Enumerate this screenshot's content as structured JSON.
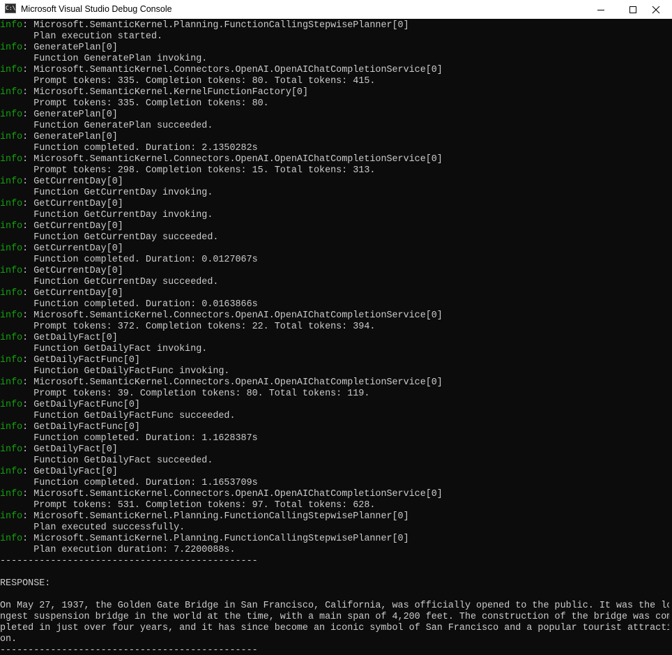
{
  "window": {
    "icon_text": "C:\\",
    "title": "Microsoft Visual Studio Debug Console"
  },
  "log_level_label": "info",
  "log_entries": [
    {
      "level": "info",
      "category": ": Microsoft.SemanticKernel.Planning.FunctionCallingStepwisePlanner[0]",
      "message": "      Plan execution started."
    },
    {
      "level": "info",
      "category": ": GeneratePlan[0]",
      "message": "      Function GeneratePlan invoking."
    },
    {
      "level": "info",
      "category": ": Microsoft.SemanticKernel.Connectors.OpenAI.OpenAIChatCompletionService[0]",
      "message": "      Prompt tokens: 335. Completion tokens: 80. Total tokens: 415."
    },
    {
      "level": "info",
      "category": ": Microsoft.SemanticKernel.KernelFunctionFactory[0]",
      "message": "      Prompt tokens: 335. Completion tokens: 80."
    },
    {
      "level": "info",
      "category": ": GeneratePlan[0]",
      "message": "      Function GeneratePlan succeeded."
    },
    {
      "level": "info",
      "category": ": GeneratePlan[0]",
      "message": "      Function completed. Duration: 2.1350282s"
    },
    {
      "level": "info",
      "category": ": Microsoft.SemanticKernel.Connectors.OpenAI.OpenAIChatCompletionService[0]",
      "message": "      Prompt tokens: 298. Completion tokens: 15. Total tokens: 313."
    },
    {
      "level": "info",
      "category": ": GetCurrentDay[0]",
      "message": "      Function GetCurrentDay invoking."
    },
    {
      "level": "info",
      "category": ": GetCurrentDay[0]",
      "message": "      Function GetCurrentDay invoking."
    },
    {
      "level": "info",
      "category": ": GetCurrentDay[0]",
      "message": "      Function GetCurrentDay succeeded."
    },
    {
      "level": "info",
      "category": ": GetCurrentDay[0]",
      "message": "      Function completed. Duration: 0.0127067s"
    },
    {
      "level": "info",
      "category": ": GetCurrentDay[0]",
      "message": "      Function GetCurrentDay succeeded."
    },
    {
      "level": "info",
      "category": ": GetCurrentDay[0]",
      "message": "      Function completed. Duration: 0.0163866s"
    },
    {
      "level": "info",
      "category": ": Microsoft.SemanticKernel.Connectors.OpenAI.OpenAIChatCompletionService[0]",
      "message": "      Prompt tokens: 372. Completion tokens: 22. Total tokens: 394."
    },
    {
      "level": "info",
      "category": ": GetDailyFact[0]",
      "message": "      Function GetDailyFact invoking."
    },
    {
      "level": "info",
      "category": ": GetDailyFactFunc[0]",
      "message": "      Function GetDailyFactFunc invoking."
    },
    {
      "level": "info",
      "category": ": Microsoft.SemanticKernel.Connectors.OpenAI.OpenAIChatCompletionService[0]",
      "message": "      Prompt tokens: 39. Completion tokens: 80. Total tokens: 119."
    },
    {
      "level": "info",
      "category": ": GetDailyFactFunc[0]",
      "message": "      Function GetDailyFactFunc succeeded."
    },
    {
      "level": "info",
      "category": ": GetDailyFactFunc[0]",
      "message": "      Function completed. Duration: 1.1628387s"
    },
    {
      "level": "info",
      "category": ": GetDailyFact[0]",
      "message": "      Function GetDailyFact succeeded."
    },
    {
      "level": "info",
      "category": ": GetDailyFact[0]",
      "message": "      Function completed. Duration: 1.1653709s"
    },
    {
      "level": "info",
      "category": ": Microsoft.SemanticKernel.Connectors.OpenAI.OpenAIChatCompletionService[0]",
      "message": "      Prompt tokens: 531. Completion tokens: 97. Total tokens: 628."
    },
    {
      "level": "info",
      "category": ": Microsoft.SemanticKernel.Planning.FunctionCallingStepwisePlanner[0]",
      "message": "      Plan executed successfully."
    },
    {
      "level": "info",
      "category": ": Microsoft.SemanticKernel.Planning.FunctionCallingStepwisePlanner[0]",
      "message": "      Plan execution duration: 7.2200088s."
    }
  ],
  "separator": "----------------------------------------------",
  "response_header": "RESPONSE:",
  "response_lines": [
    "On May 27, 1937, the Golden Gate Bridge in San Francisco, California, was officially opened to the public. It was the lo",
    "ngest suspension bridge in the world at the time, with a main span of 4,200 feet. The construction of the bridge was com",
    "pleted in just over four years, and it has since become an iconic symbol of San Francisco and a popular tourist attracti",
    "on."
  ],
  "colors": {
    "background": "#0c0c0c",
    "text": "#cccccc",
    "info_level": "#13a10e",
    "titlebar": "#ffffff"
  }
}
